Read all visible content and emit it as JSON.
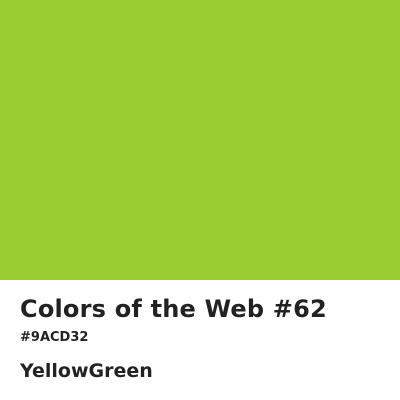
{
  "color": {
    "hex": "#9ACD32",
    "name": "YellowGreen"
  },
  "title": "Colors of the Web #62",
  "text_color": "#222222",
  "background": "#ffffff"
}
